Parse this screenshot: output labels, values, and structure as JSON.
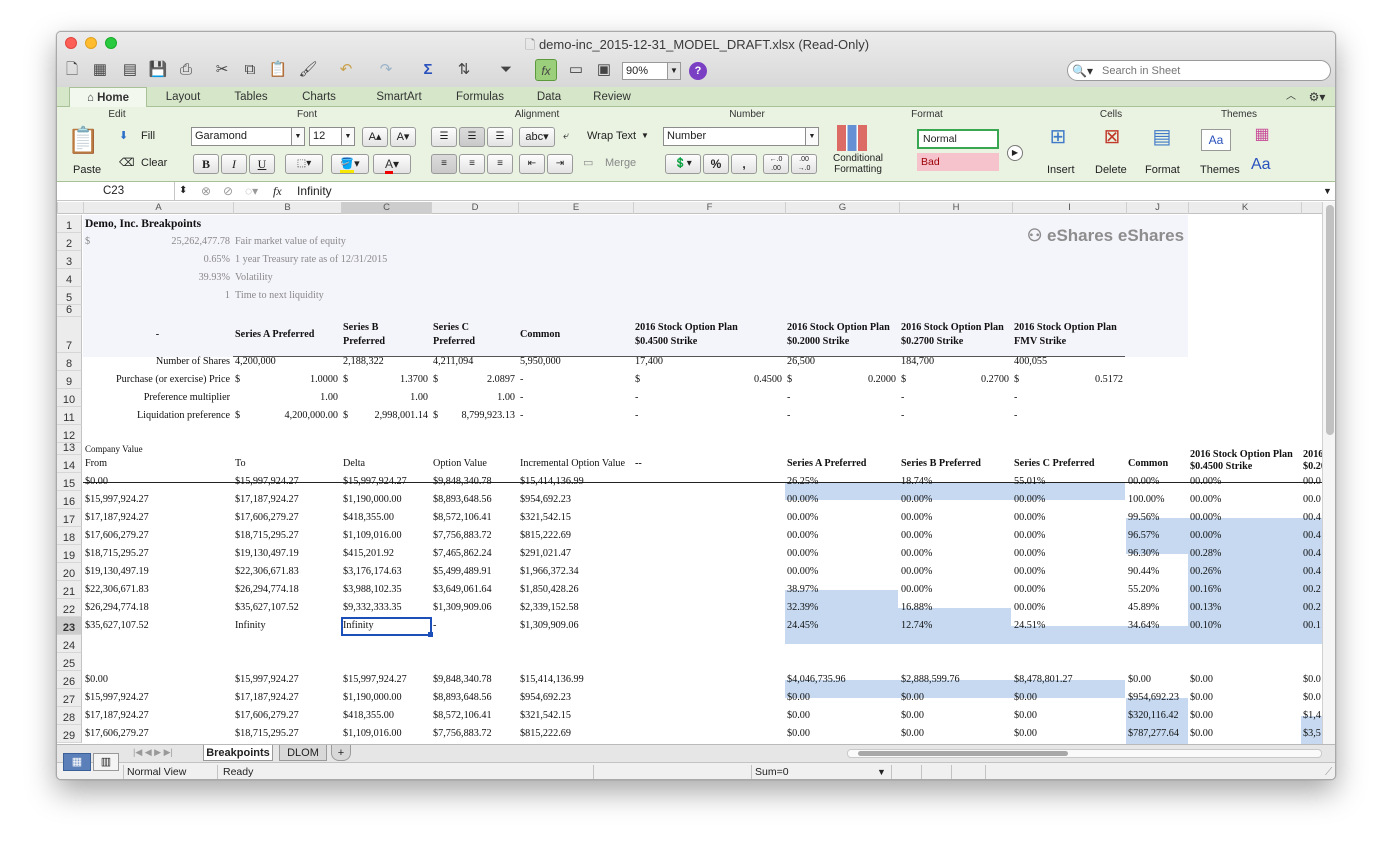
{
  "window": {
    "title": "demo-inc_2015-12-31_MODEL_DRAFT.xlsx  (Read-Only)"
  },
  "colors": {
    "close": "#fd5f57",
    "minimize": "#febc2e",
    "maximize": "#29c940",
    "ribbon_green": "#d6e7c9",
    "highlight": "#c6d9f0",
    "selection": "#1d4fb8"
  },
  "toolbar": {
    "zoom": "90%",
    "search_placeholder": "Search in Sheet",
    "icons": [
      "new-icon",
      "templates-icon",
      "open-icon",
      "save-icon",
      "print-icon",
      "cut-icon",
      "copy-icon",
      "paste-icon",
      "format-painter-icon",
      "undo-icon",
      "redo-icon",
      "autosum-icon",
      "sort-icon",
      "filter-icon",
      "function-icon",
      "show-formulas-icon",
      "gallery-icon",
      "help-icon"
    ]
  },
  "ribbon_tabs": [
    "Home",
    "Layout",
    "Tables",
    "Charts",
    "SmartArt",
    "Formulas",
    "Data",
    "Review"
  ],
  "ribbon": {
    "groups": {
      "edit": "Edit",
      "font": "Font",
      "alignment": "Alignment",
      "number": "Number",
      "format": "Format",
      "cells": "Cells",
      "themes": "Themes"
    },
    "paste": "Paste",
    "fill": "Fill",
    "clear": "Clear",
    "font_name": "Garamond",
    "font_size": "12",
    "bold": "B",
    "italic": "I",
    "underline": "U",
    "orient": "abc",
    "wrap": "Wrap Text",
    "merge": "Merge",
    "number_format": "Number",
    "percent": "%",
    "comma": ",",
    "dec_inc": "←.0 .00",
    "dec_dec": ".00 →.0",
    "cond_format_1": "Conditional",
    "cond_format_2": "Formatting",
    "style_normal": "Normal",
    "style_bad": "Bad",
    "insert": "Insert",
    "delete": "Delete",
    "format": "Format",
    "themes": "Themes",
    "theme_font": "Aa"
  },
  "formula_bar": {
    "name_box": "C23",
    "fx": "fx",
    "value": "Infinity"
  },
  "columns": [
    "A",
    "B",
    "C",
    "D",
    "E",
    "F",
    "G",
    "H",
    "I",
    "J",
    "K"
  ],
  "rows": [
    "1",
    "2",
    "3",
    "4",
    "5",
    "6",
    "7",
    "8",
    "9",
    "10",
    "11",
    "12",
    "13",
    "14",
    "15",
    "16",
    "17",
    "18",
    "19",
    "20",
    "21",
    "22",
    "23",
    "24",
    "25",
    "26",
    "27",
    "28",
    "29"
  ],
  "logo": "eShares eShares",
  "header": {
    "title": "Demo, Inc. Breakpoints",
    "fmv_sym": "$",
    "fmv": "25,262,477.78",
    "fmv_lbl": "Fair market value of equity",
    "rate": "0.65%",
    "rate_lbl": "1 year Treasury rate as of 12/31/2015",
    "vol": "39.93%",
    "vol_lbl": "Volatility",
    "time": "1",
    "time_lbl": "Time to next liquidity",
    "a7": "-",
    "series_a": "Series A Preferred",
    "series_b_1": "Series B",
    "series_b_2": "Preferred",
    "series_c_1": "Series C",
    "series_c_2": "Preferred",
    "common": "Common",
    "opt1_1": "2016 Stock Option Plan",
    "opt1_2": "$0.4500 Strike",
    "opt2_1": "2016 Stock Option Plan",
    "opt2_2": "$0.2000 Strike",
    "opt3_1": "2016 Stock Option Plan",
    "opt3_2": "$0.2700 Strike",
    "opt4_1": "2016 Stock Option Plan",
    "opt4_2": "FMV Strike"
  },
  "shares": {
    "label": "Number of Shares",
    "a": "4,200,000",
    "b": "2,188,322",
    "c": "4,211,094",
    "common": "5,950,000",
    "o1": "17,400",
    "o2": "26,500",
    "o3": "184,700",
    "o4": "400,055"
  },
  "price": {
    "label": "Purchase (or exercise) Price",
    "sym": "$",
    "a": "1.0000",
    "b": "1.3700",
    "c": "2.0897",
    "common": "-",
    "o1": "0.4500",
    "o2": "0.2000",
    "o3": "0.2700",
    "o4": "0.5172"
  },
  "pref": {
    "label": "Preference multiplier",
    "a": "1.00",
    "b": "1.00",
    "c": "1.00",
    "dash": "-"
  },
  "liq": {
    "label": "Liquidation preference",
    "sym": "$",
    "a": "4,200,000.00",
    "b": "2,998,001.14",
    "c": "8,799,923.13",
    "dash": "-"
  },
  "table": {
    "company_value": "Company Value",
    "headers": {
      "from": "From",
      "to": "To",
      "delta": "Delta",
      "option_value": "Option Value",
      "incremental": "Incremental Option Value",
      "dashes": "--",
      "sa": "Series A Preferred",
      "sb": "Series B  Preferred",
      "sc": "Series C Preferred",
      "common": "Common",
      "k1": "2016 Stock Option Plan",
      "k2": "$0.4500 Strike",
      "l1": "2016",
      "l2": "$0.20"
    },
    "rows": [
      [
        "$0.00",
        "$15,997,924.27",
        "$15,997,924.27",
        "$9,848,340.78",
        "$15,414,136.99",
        "26.25%",
        "18.74%",
        "55.01%",
        "00.00%",
        "00.00%",
        "00.0"
      ],
      [
        "$15,997,924.27",
        "$17,187,924.27",
        "$1,190,000.00",
        "$8,893,648.56",
        "$954,692.23",
        "00.00%",
        "00.00%",
        "00.00%",
        "100.00%",
        "00.00%",
        "00.0"
      ],
      [
        "$17,187,924.27",
        "$17,606,279.27",
        "$418,355.00",
        "$8,572,106.41",
        "$321,542.15",
        "00.00%",
        "00.00%",
        "00.00%",
        "99.56%",
        "00.00%",
        "00.4"
      ],
      [
        "$17,606,279.27",
        "$18,715,295.27",
        "$1,109,016.00",
        "$7,756,883.72",
        "$815,222.69",
        "00.00%",
        "00.00%",
        "00.00%",
        "96.57%",
        "00.00%",
        "00.4"
      ],
      [
        "$18,715,295.27",
        "$19,130,497.19",
        "$415,201.92",
        "$7,465,862.24",
        "$291,021.47",
        "00.00%",
        "00.00%",
        "00.00%",
        "96.30%",
        "00.28%",
        "00.4"
      ],
      [
        "$19,130,497.19",
        "$22,306,671.83",
        "$3,176,174.63",
        "$5,499,489.91",
        "$1,966,372.34",
        "00.00%",
        "00.00%",
        "00.00%",
        "90.44%",
        "00.26%",
        "00.4"
      ],
      [
        "$22,306,671.83",
        "$26,294,774.18",
        "$3,988,102.35",
        "$3,649,061.64",
        "$1,850,428.26",
        "38.97%",
        "00.00%",
        "00.00%",
        "55.20%",
        "00.16%",
        "00.2"
      ],
      [
        "$26,294,774.18",
        "$35,627,107.52",
        "$9,332,333.35",
        "$1,309,909.06",
        "$2,339,152.58",
        "32.39%",
        "16.88%",
        "00.00%",
        "45.89%",
        "00.13%",
        "00.2"
      ],
      [
        "$35,627,107.52",
        "Infinity",
        "Infinity",
        "-",
        "$1,309,909.06",
        "24.45%",
        "12.74%",
        "24.51%",
        "34.64%",
        "00.10%",
        "00.1"
      ]
    ],
    "rows2": [
      [
        "$0.00",
        "$15,997,924.27",
        "$15,997,924.27",
        "$9,848,340.78",
        "$15,414,136.99",
        "$4,046,735.96",
        "$2,888,599.76",
        "$8,478,801.27",
        "$0.00",
        "$0.00",
        "$0.0"
      ],
      [
        "$15,997,924.27",
        "$17,187,924.27",
        "$1,190,000.00",
        "$8,893,648.56",
        "$954,692.23",
        "$0.00",
        "$0.00",
        "$0.00",
        "$954,692.23",
        "$0.00",
        "$0.0"
      ],
      [
        "$17,187,924.27",
        "$17,606,279.27",
        "$418,355.00",
        "$8,572,106.41",
        "$321,542.15",
        "$0.00",
        "$0.00",
        "$0.00",
        "$320,116.42",
        "$0.00",
        "$1,4"
      ],
      [
        "$17,606,279.27",
        "$18,715,295.27",
        "$1,109,016.00",
        "$7,756,883.72",
        "$815,222.69",
        "$0.00",
        "$0.00",
        "$0.00",
        "$787,277.64",
        "$0.00",
        "$3,5"
      ]
    ]
  },
  "sheet_tabs": [
    "Breakpoints",
    "DLOM"
  ],
  "add_sheet": "+",
  "status": {
    "view": "Normal View",
    "ready": "Ready",
    "sum": "Sum=0"
  }
}
